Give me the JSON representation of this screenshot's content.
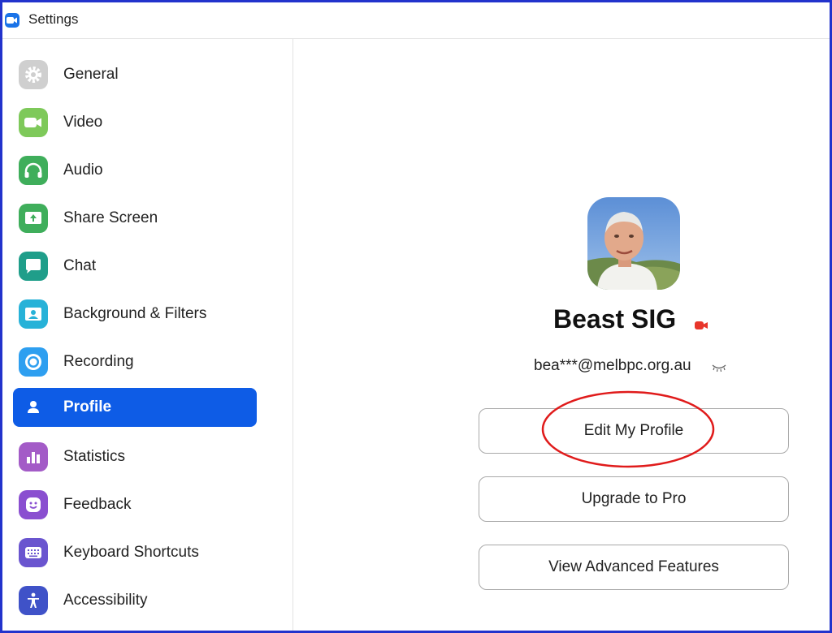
{
  "window": {
    "title": "Settings"
  },
  "sidebar": {
    "items": [
      {
        "label": "General",
        "icon": "gear-icon",
        "color": "#cfcfcf",
        "active": false
      },
      {
        "label": "Video",
        "icon": "video-icon",
        "color": "#7ec95a",
        "active": false
      },
      {
        "label": "Audio",
        "icon": "headphones-icon",
        "color": "#3fae5b",
        "active": false
      },
      {
        "label": "Share Screen",
        "icon": "share-screen-icon",
        "color": "#3fae5b",
        "active": false
      },
      {
        "label": "Chat",
        "icon": "chat-icon",
        "color": "#1f9e8a",
        "active": false
      },
      {
        "label": "Background & Filters",
        "icon": "background-icon",
        "color": "#27b2d8",
        "active": false
      },
      {
        "label": "Recording",
        "icon": "recording-icon",
        "color": "#2e9ff0",
        "active": false
      },
      {
        "label": "Profile",
        "icon": "person-icon",
        "color": "#0e5ce6",
        "active": true
      },
      {
        "label": "Statistics",
        "icon": "statistics-icon",
        "color": "#a35bc7",
        "active": false
      },
      {
        "label": "Feedback",
        "icon": "feedback-icon",
        "color": "#8a4fd0",
        "active": false
      },
      {
        "label": "Keyboard Shortcuts",
        "icon": "keyboard-icon",
        "color": "#6a55cf",
        "active": false
      },
      {
        "label": "Accessibility",
        "icon": "accessibility-icon",
        "color": "#3f52c8",
        "active": false
      }
    ]
  },
  "profile": {
    "name": "Beast SIG",
    "email": "bea***@melbpc.org.au",
    "buttons": {
      "edit": "Edit My Profile",
      "upgrade": "Upgrade to Pro",
      "advanced": "View Advanced Features"
    }
  },
  "colors": {
    "accent": "#0e5ce6",
    "frame": "#2233cc",
    "highlight": "#e01b1b",
    "recording_badge": "#e8362b"
  }
}
